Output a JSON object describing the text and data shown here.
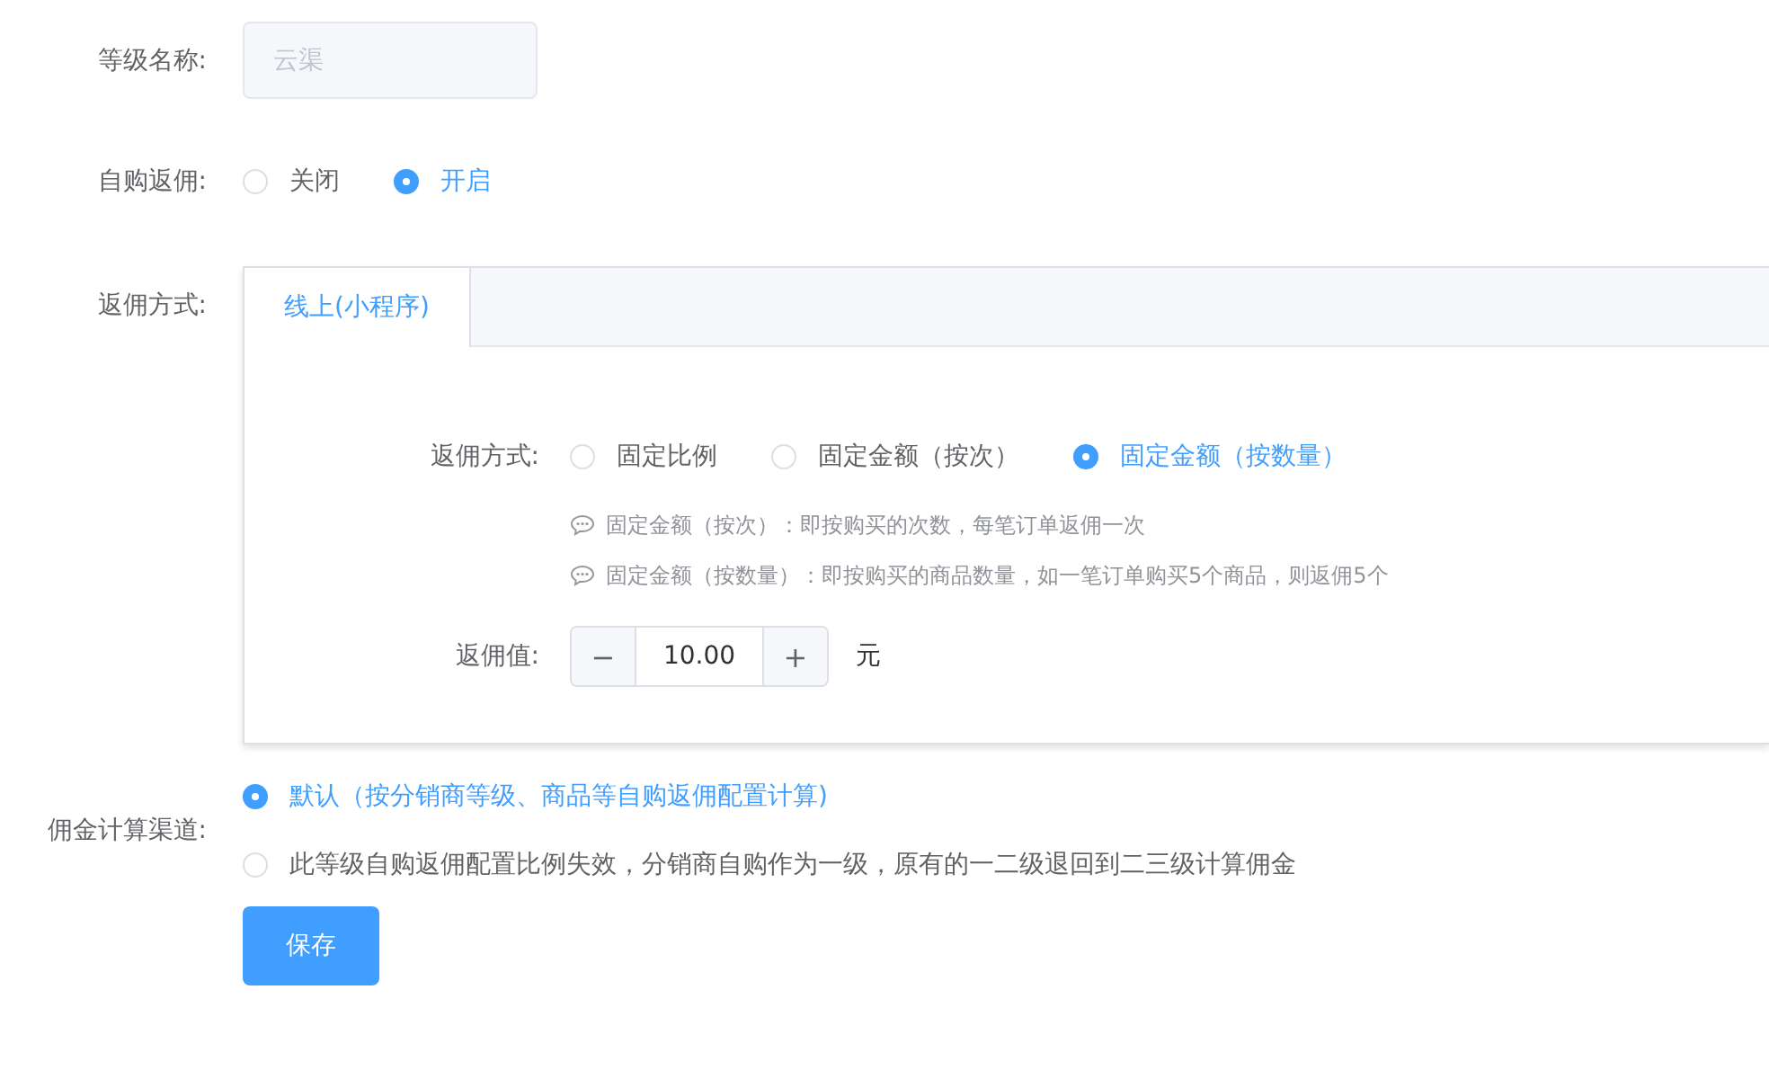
{
  "level_name": {
    "label": "等级名称:",
    "value": "云渠",
    "disabled": true
  },
  "self_purchase": {
    "label": "自购返佣:",
    "options": [
      {
        "label": "关闭",
        "selected": false
      },
      {
        "label": "开启",
        "selected": true
      }
    ]
  },
  "commission_method": {
    "label": "返佣方式:",
    "tabs": [
      {
        "label": "线上(小程序)",
        "selected": true
      }
    ],
    "method": {
      "label": "返佣方式:",
      "options": [
        {
          "label": "固定比例",
          "selected": false
        },
        {
          "label": "固定金额（按次）",
          "selected": false
        },
        {
          "label": "固定金额（按数量）",
          "selected": true
        }
      ]
    },
    "hints": [
      "固定金额（按次）：即按购买的次数，每笔订单返佣一次",
      "固定金额（按数量）：即按购买的商品数量，如一笔订单购买5个商品，则返佣5个"
    ],
    "value": {
      "label": "返佣值:",
      "minus": "−",
      "amount": "10.00",
      "plus": "+",
      "unit": "元"
    }
  },
  "calc_channel": {
    "label": "佣金计算渠道:",
    "options": [
      {
        "label": "默认（按分销商等级、商品等自购返佣配置计算)",
        "selected": true
      },
      {
        "label": "此等级自购返佣配置比例失效，分销商自购作为一级，原有的一二级退回到二三级计算佣金",
        "selected": false
      }
    ]
  },
  "save_button": "保存"
}
